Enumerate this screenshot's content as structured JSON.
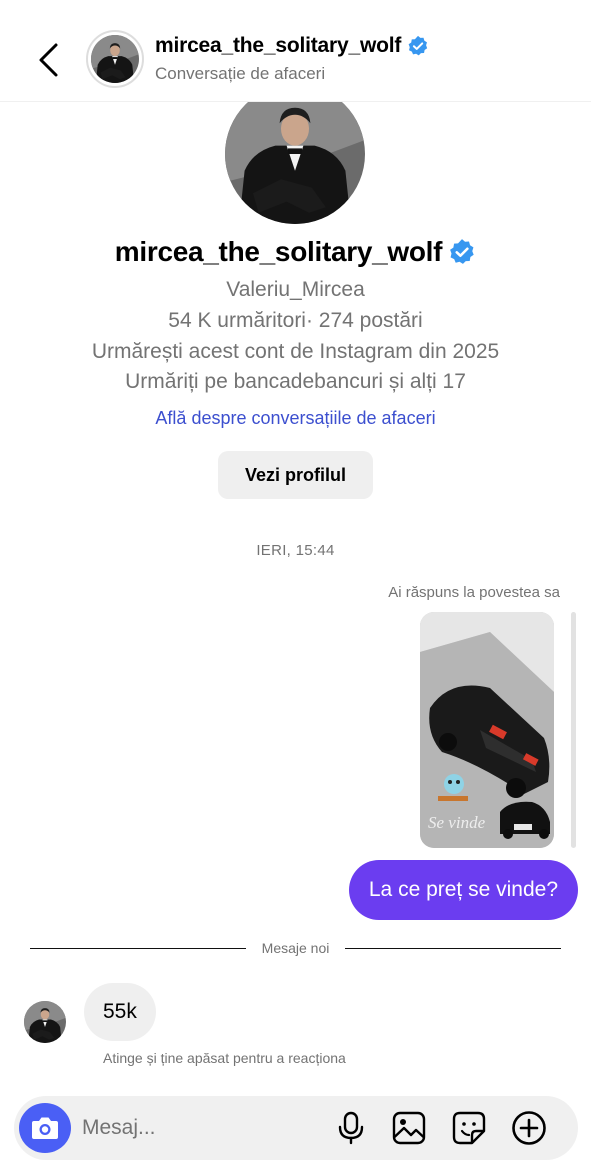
{
  "header": {
    "username": "mircea_the_solitary_wolf",
    "subtitle": "Conversație de afaceri"
  },
  "profile": {
    "username": "mircea_the_solitary_wolf",
    "full_name": "Valeriu_Mircea",
    "stats": "54 K urmăritori· 274 postări",
    "following_since": "Urmărești acest cont de Instagram din 2025",
    "followed_by": "Urmăriți pe bancadebancuri și alți 17",
    "business_link": "Află despre conversațiile de afaceri",
    "view_profile_label": "Vezi profilul"
  },
  "conversation": {
    "timestamp": "IERI, 15:44",
    "story_reply_caption": "Ai răspuns la povestea sa",
    "story_sticker_text": "Se vinde",
    "sent_message": "La ce preț se vinde?",
    "new_messages_label": "Mesaje noi",
    "received_message": "55k",
    "reaction_hint": "Atinge și ține apăsat pentru a reacționa"
  },
  "composer": {
    "placeholder": "Mesaj..."
  },
  "icons": {
    "back": "chevron-left-icon",
    "verified": "verified-badge-icon",
    "camera": "camera-icon",
    "mic": "microphone-icon",
    "gallery": "gallery-icon",
    "sticker": "sticker-icon",
    "plus": "plus-circle-icon"
  },
  "colors": {
    "accent": "#6b3df0",
    "verified": "#3797f0",
    "camera_button": "#4a5ff5",
    "link": "#3c4fcf"
  }
}
